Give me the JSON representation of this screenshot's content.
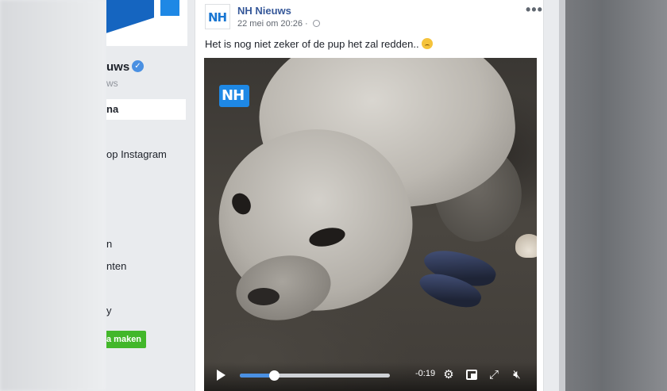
{
  "sidebar": {
    "page_name": "uws",
    "page_handle": "ws",
    "nav_active": "na",
    "nav_items": [
      {
        "label": "op Instagram"
      },
      {
        "label": "n"
      },
      {
        "label": "nten"
      },
      {
        "label": "y"
      }
    ],
    "create_button": "a maken"
  },
  "post": {
    "author": "NH Nieuws",
    "avatar_text": "NH",
    "timestamp": "22 mei om 20:26",
    "separator": "·",
    "text": "Het is nog niet zeker of de pup het zal redden..",
    "emoji": "worried-face-emoji",
    "more_label": "•••"
  },
  "video": {
    "logo_text": "NH",
    "time_remaining": "-0:19",
    "progress": 0.23,
    "icons": [
      "play-icon",
      "gear-icon",
      "picture-in-picture-icon",
      "fullscreen-icon",
      "volume-muted-icon"
    ]
  },
  "colors": {
    "link": "#365899",
    "accent_blue": "#4a90e2",
    "create_green": "#42b72a"
  }
}
